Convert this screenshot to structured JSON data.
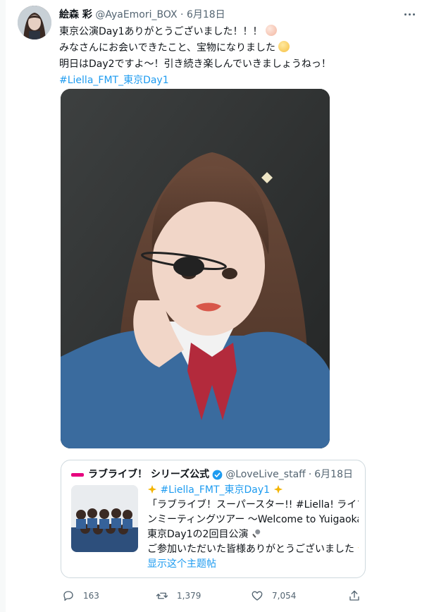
{
  "tweet": {
    "author_name": "絵森 彩",
    "handle": "@AyaEmori_BOX",
    "dot": "·",
    "date": "6月18日",
    "lines": {
      "l1": "東京公演Day1ありがとうございました！！！",
      "l2": "みなさんにお会いできたこと、宝物になりました",
      "l3": "明日はDay2ですよ〜！引き続き楽しんでいきましょうねっ！",
      "hashtag": "#Liella_FMT_東京Day1"
    },
    "inline_icons": [
      "heart-hands-icon",
      "relieved-face-icon"
    ]
  },
  "quote": {
    "author_name": "ラブライブ！ シリーズ公式",
    "handle": "@LoveLive_staff",
    "dot": "·",
    "date": "6月18日",
    "lines": {
      "l1": "#Liella_FMT_東京Day1",
      "l2": "「ラブライブ！スーパースター!! #Liella! ライブ＆ファ",
      "l3": "ンミーティングツアー 〜Welcome to Yuigaoka!!〜」",
      "l4": "東京Day1の2回目公演",
      "l5": "ご参加いただいた皆様ありがとうございました",
      "l5_tail": "…",
      "show_more": "显示这个主题帖"
    },
    "icons": [
      "sparkle-icon",
      "microphone-icon",
      "star-icon"
    ]
  },
  "actions": {
    "reply_count": "163",
    "retweet_count": "1,379",
    "like_count": "7,054"
  },
  "colors": {
    "link": "#1d9bf0",
    "secondary_text": "#536471",
    "brand_pink": "#e6007e"
  }
}
